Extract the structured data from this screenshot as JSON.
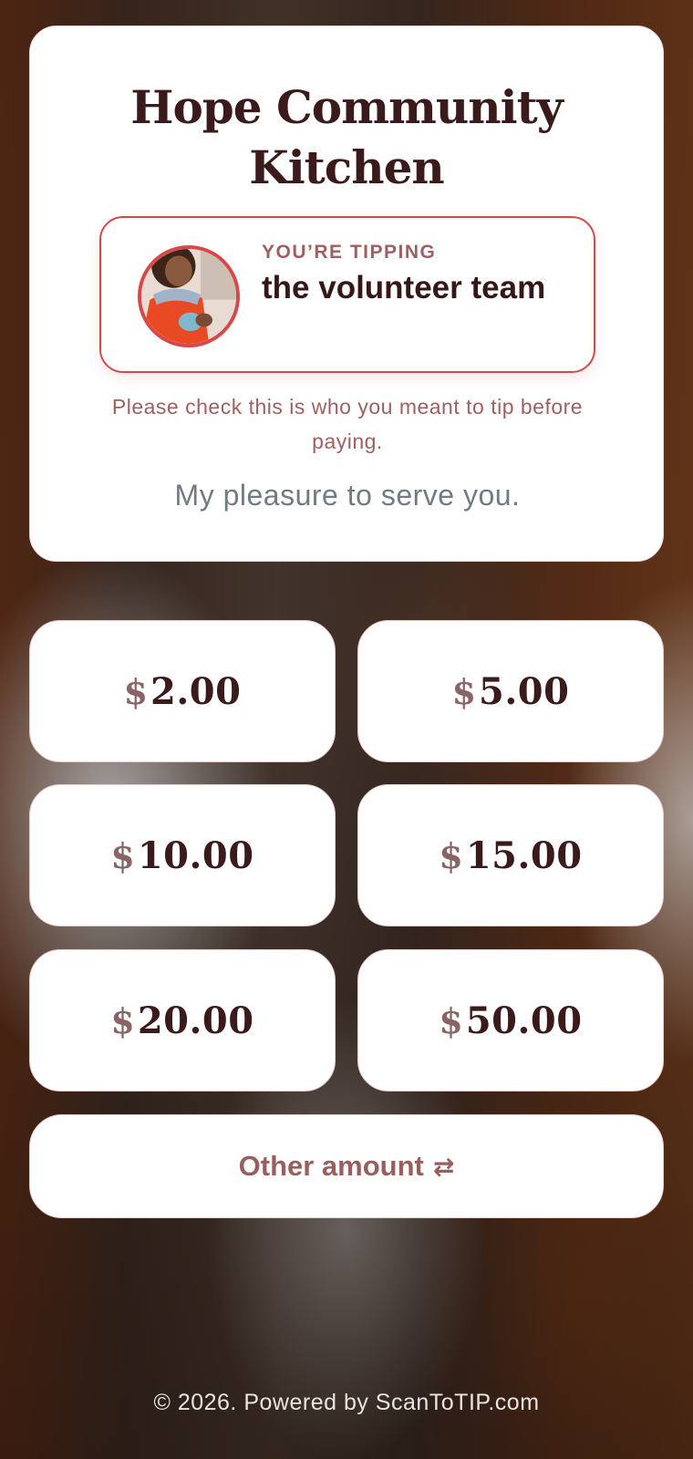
{
  "header": {
    "org_name": "Hope Community Kitchen",
    "recipient_label": "YOU’RE TIPPING",
    "recipient_name": "the volunteer team",
    "check_note": "Please check this is who you meant to tip before paying.",
    "message": "My pleasure to serve you."
  },
  "amounts": [
    {
      "currency": "$",
      "value": "2.00"
    },
    {
      "currency": "$",
      "value": "5.00"
    },
    {
      "currency": "$",
      "value": "10.00"
    },
    {
      "currency": "$",
      "value": "15.00"
    },
    {
      "currency": "$",
      "value": "20.00"
    },
    {
      "currency": "$",
      "value": "50.00"
    }
  ],
  "other": {
    "label": "Other amount",
    "icon": "⇄"
  },
  "footer": {
    "text": "© 2026. Powered by ScanToTIP.com"
  },
  "colors": {
    "accent": "#d94848",
    "text_dark": "#3a1a1a",
    "text_muted": "#a0605f"
  }
}
